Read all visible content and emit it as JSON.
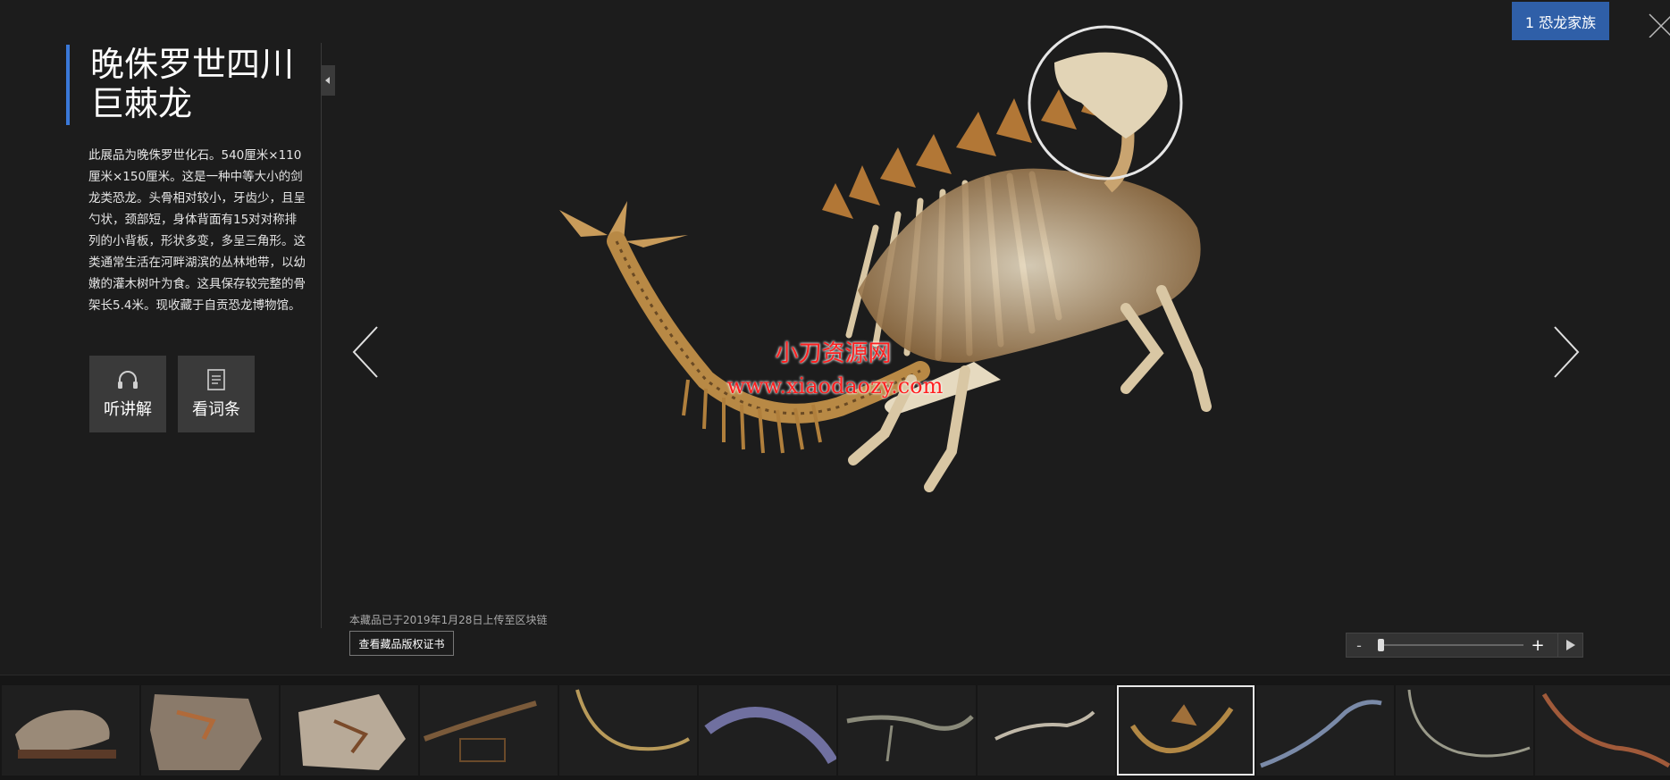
{
  "exhibit": {
    "title": "晚侏罗世四川巨棘龙",
    "description": "此展品为晚侏罗世化石。540厘米×110厘米×150厘米。这是一种中等大小的剑龙类恐龙。头骨相对较小，牙齿少，且呈勺状，颈部短，身体背面有15对对称排列的小背板，形状多变，多呈三角形。这类通常生活在河畔湖滨的丛林地带，以幼嫩的灌木树叶为食。这具保存较完整的骨架长5.4米。现收藏于自贡恐龙博物馆。"
  },
  "actions": {
    "listen_label": "听讲解",
    "entry_label": "看词条"
  },
  "family_button_label": "1 恐龙家族",
  "watermark": {
    "line1": "小刀资源网",
    "line2": "www.xiaodaozy.com"
  },
  "blockchain_note": "本藏品已于2019年1月28日上传至区块链",
  "certificate_button_label": "查看藏品版权证书",
  "zoom": {
    "minus_label": "-",
    "plus_label": "+",
    "level": 0.02
  },
  "thumbnails": {
    "count": 12,
    "active_index": 8
  },
  "colors": {
    "background": "#1c1c1c",
    "accent_blue": "#2f5fa8",
    "title_bar": "#3a78d8",
    "watermark_red": "#ff1f1f"
  }
}
